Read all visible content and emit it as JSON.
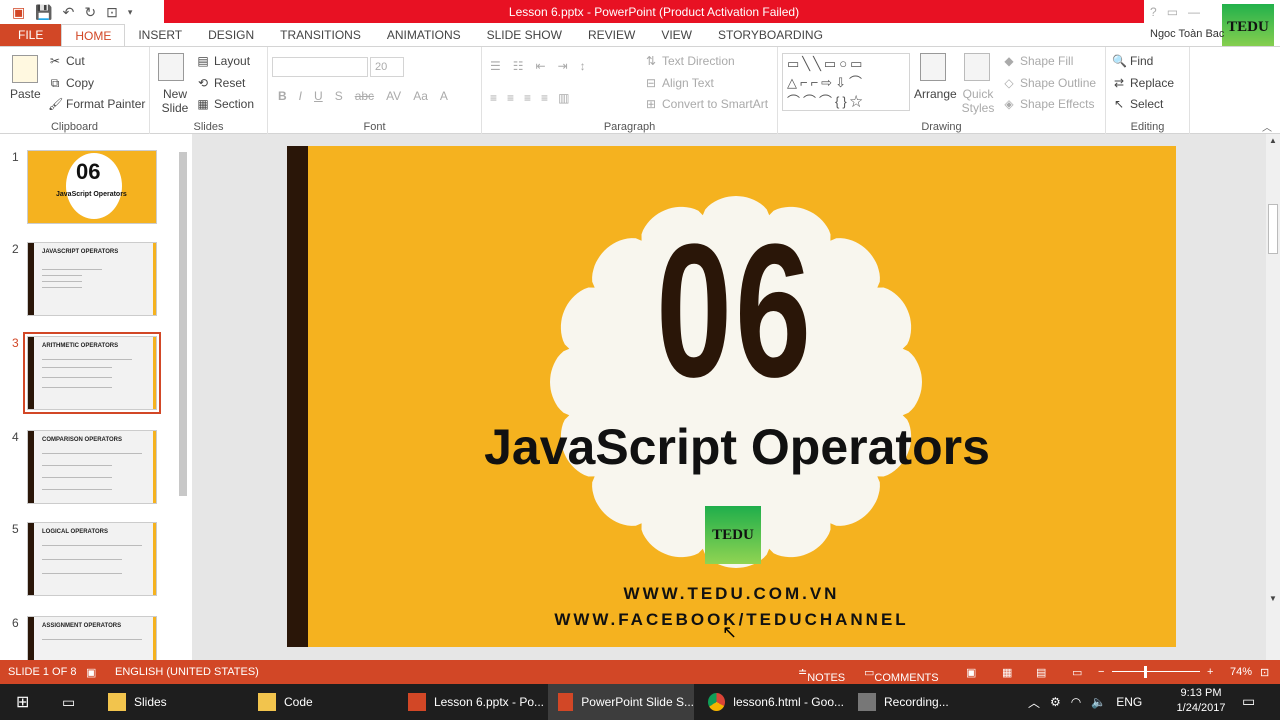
{
  "window": {
    "title": "Lesson 6.pptx - PowerPoint (Product Activation Failed)",
    "user": "Ngoc Toàn Bac",
    "logo_text": "TEDU"
  },
  "tabs": [
    "FILE",
    "HOME",
    "INSERT",
    "DESIGN",
    "TRANSITIONS",
    "ANIMATIONS",
    "SLIDE SHOW",
    "REVIEW",
    "VIEW",
    "STORYBOARDING"
  ],
  "ribbon": {
    "clipboard": {
      "label": "Clipboard",
      "paste": "Paste",
      "cut": "Cut",
      "copy": "Copy",
      "format_painter": "Format Painter"
    },
    "slides": {
      "label": "Slides",
      "new_slide": "New Slide",
      "layout": "Layout",
      "reset": "Reset",
      "section": "Section"
    },
    "font": {
      "label": "Font",
      "size": "20"
    },
    "paragraph": {
      "label": "Paragraph",
      "text_direction": "Text Direction",
      "align_text": "Align Text",
      "convert": "Convert to SmartArt"
    },
    "drawing": {
      "label": "Drawing",
      "arrange": "Arrange",
      "quick_styles": "Quick Styles",
      "shape_fill": "Shape Fill",
      "shape_outline": "Shape Outline",
      "shape_effects": "Shape Effects"
    },
    "editing": {
      "label": "Editing",
      "find": "Find",
      "replace": "Replace",
      "select": "Select"
    }
  },
  "thumbnails": [
    {
      "num": "1",
      "title": "JavaScript Operators",
      "number": "06"
    },
    {
      "num": "2",
      "title": "JAVASCRIPT OPERATORS"
    },
    {
      "num": "3",
      "title": "ARITHMETIC OPERATORS"
    },
    {
      "num": "4",
      "title": "COMPARISON OPERATORS"
    },
    {
      "num": "5",
      "title": "LOGICAL OPERATORS"
    },
    {
      "num": "6",
      "title": "ASSIGNMENT OPERATORS"
    }
  ],
  "slide": {
    "number": "06",
    "title": "JavaScript Operators",
    "logo": "TEDU",
    "url1": "WWW.TEDU.COM.VN",
    "url2": "WWW.FACEBOOK/TEDUCHANNEL"
  },
  "status": {
    "slide": "SLIDE 1 OF 8",
    "language": "ENGLISH (UNITED STATES)",
    "notes": "NOTES",
    "comments": "COMMENTS",
    "zoom": "74%"
  },
  "taskbar": {
    "items": [
      "Slides",
      "Code",
      "Lesson 6.pptx - Po...",
      "PowerPoint Slide S...",
      "lesson6.html - Goo...",
      "Recording..."
    ],
    "lang": "ENG",
    "time": "9:13 PM",
    "date": "1/24/2017"
  },
  "colors": {
    "accent": "#d24726",
    "slide_bg": "#f5b21f",
    "dark": "#2a1608",
    "title_red": "#e81123"
  }
}
